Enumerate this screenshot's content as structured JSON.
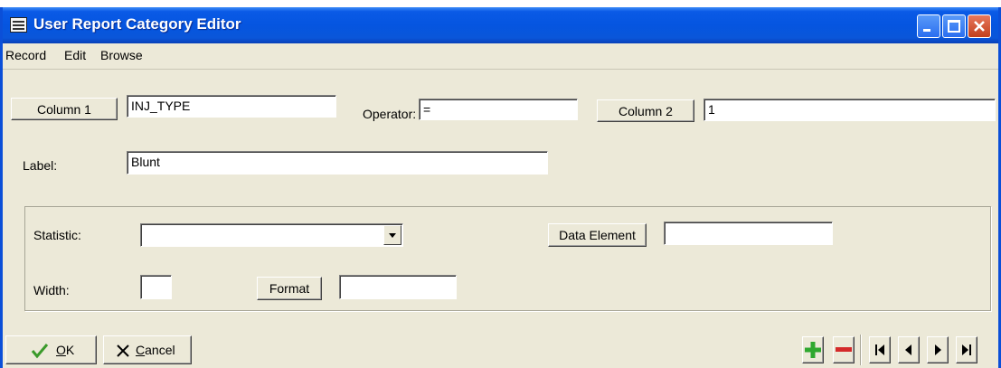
{
  "window": {
    "title": "User Report Category Editor"
  },
  "menu": [
    "Record",
    "Edit",
    "Browse"
  ],
  "row1": {
    "column1_button": "Column 1",
    "column1_value": "INJ_TYPE",
    "operator_label": "Operator:",
    "operator_value": "=",
    "column2_button": "Column 2",
    "column2_value": "1"
  },
  "label_row": {
    "label": "Label:",
    "value": "Blunt"
  },
  "group": {
    "statistic_label": "Statistic:",
    "statistic_value": "",
    "data_element_button": "Data Element",
    "data_element_value": "",
    "width_label": "Width:",
    "width_value": "",
    "format_button": "Format",
    "format_value": ""
  },
  "footer": {
    "ok_mnemonic": "O",
    "ok_rest": "K",
    "cancel_mnemonic": "C",
    "cancel_rest": "ancel"
  },
  "icons": {
    "app": "form-icon",
    "ok": "checkmark-icon",
    "cancel": "x-icon",
    "add": "plus-icon",
    "delete": "minus-icon",
    "first": "first-record-icon",
    "prev": "previous-record-icon",
    "next": "next-record-icon",
    "last": "last-record-icon"
  },
  "colors": {
    "titlebar": "#0555e0",
    "face": "#ece9d8",
    "add_green": "#2fa82f",
    "delete_red": "#d42a2a"
  }
}
